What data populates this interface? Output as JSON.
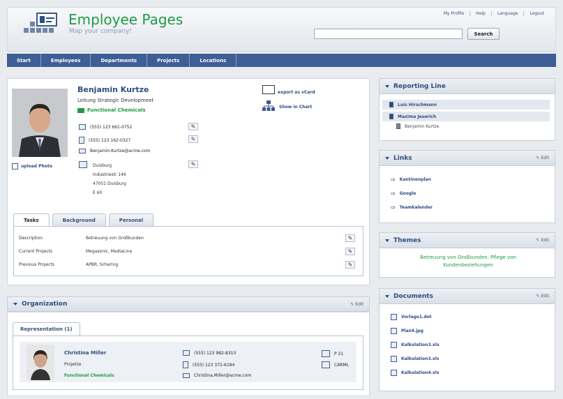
{
  "header": {
    "title": "Employee Pages",
    "subtitle": "Map your company!",
    "toplinks": [
      "My Profile",
      "Help",
      "Language",
      "Logout"
    ],
    "search_placeholder": "",
    "search_button": "Search"
  },
  "nav": [
    "Start",
    "Employees",
    "Departments",
    "Projects",
    "Locations"
  ],
  "person": {
    "name": "Benjamin Kurtze",
    "role": "Leitung Strategic Developmeet",
    "department": "Functional Chemicals",
    "phone": "(555) 123 661-0752",
    "mobile": "(555) 123 162-0327",
    "email": "Benjamin.Kurtze@acme.com",
    "address": [
      "Duisburg",
      "Industriestr 146",
      "47051 Duisburg",
      "E 60"
    ],
    "upload_photo": "upload Photo",
    "export_vcard": "export as vCard",
    "show_chart": "Show in Chart"
  },
  "tabs": [
    {
      "label": "Tasks",
      "active": true
    },
    {
      "label": "Background",
      "active": false
    },
    {
      "label": "Personal",
      "active": false
    }
  ],
  "tasks": [
    {
      "key": "Description",
      "value": "Betreuung von Großkunden"
    },
    {
      "key": "Current Projects",
      "value": "Megasonic, MediaLine"
    },
    {
      "key": "Previous Projects",
      "value": "APBR, Schering"
    }
  ],
  "organization": {
    "title": "Organization",
    "edit": "Edit",
    "tab": "Representation (1)",
    "rep": {
      "name": "Christina Miller",
      "group": "Projekte",
      "department": "Functional Chemicals",
      "phone": "(555) 123 982-8310",
      "mobile": "(555) 123 372-6184",
      "email": "Christina.Miller@acme.com",
      "room": "P 21",
      "location": "CARML"
    }
  },
  "reporting": {
    "title": "Reporting Line",
    "items": [
      "Luis Hirschmann",
      "Maxima Jeserich",
      "Benjamin Kurtze"
    ]
  },
  "links": {
    "title": "Links",
    "edit": "Edit",
    "items": [
      "Kantinenplan",
      "Google",
      "Teamkalender"
    ]
  },
  "themes": {
    "title": "Themes",
    "edit": "Edit",
    "text": "Betreuung von Großkunden, Pflege von Kundenbeziehungen"
  },
  "documents": {
    "title": "Documents",
    "edit": "Edit",
    "items": [
      "Vorlage1.dot",
      "Plan4.jpg",
      "Kalkulation3.xls",
      "Kalkulation3.xls",
      "Kalkulation4.xls"
    ]
  }
}
